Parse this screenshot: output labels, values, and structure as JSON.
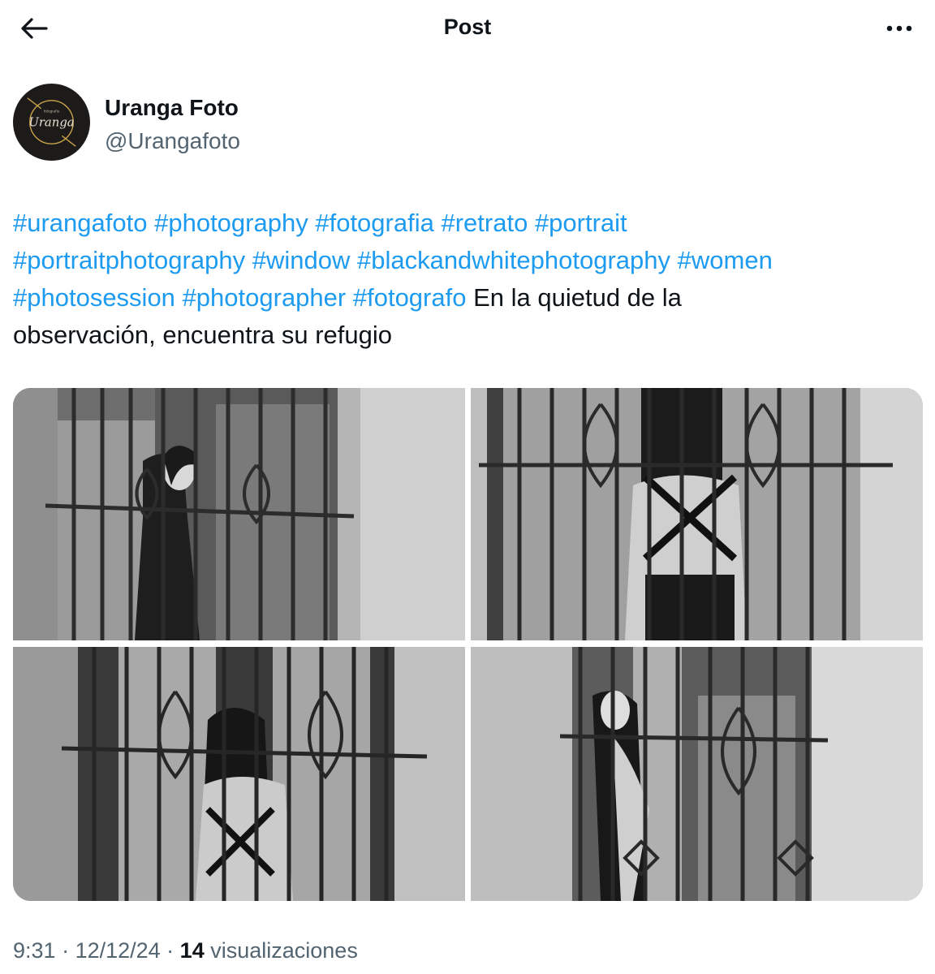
{
  "header": {
    "title": "Post"
  },
  "author": {
    "name": "Uranga Foto",
    "handle": "@Urangafoto",
    "avatar_text": "Uranga",
    "avatar_subtext": "fotografía"
  },
  "tweet": {
    "lines": [
      [
        {
          "type": "tag",
          "text": "#urangafoto"
        },
        {
          "type": "text",
          "text": " "
        },
        {
          "type": "tag",
          "text": "#photography"
        },
        {
          "type": "text",
          "text": " "
        },
        {
          "type": "tag",
          "text": "#fotografia"
        },
        {
          "type": "text",
          "text": " "
        },
        {
          "type": "tag",
          "text": "#retrato"
        },
        {
          "type": "text",
          "text": " "
        },
        {
          "type": "tag",
          "text": "#portrait"
        }
      ],
      [
        {
          "type": "tag",
          "text": "#portraitphotography"
        },
        {
          "type": "text",
          "text": " "
        },
        {
          "type": "tag",
          "text": "#window"
        },
        {
          "type": "text",
          "text": " "
        },
        {
          "type": "tag",
          "text": "#blackandwhitephotography"
        },
        {
          "type": "text",
          "text": " "
        },
        {
          "type": "tag",
          "text": "#women"
        }
      ],
      [
        {
          "type": "tag",
          "text": "#photosession"
        },
        {
          "type": "text",
          "text": " "
        },
        {
          "type": "tag",
          "text": "#photographer"
        },
        {
          "type": "text",
          "text": " "
        },
        {
          "type": "tag",
          "text": "#fotografo"
        },
        {
          "type": "text",
          "text": " En la quietud de la"
        }
      ],
      [
        {
          "type": "text",
          "text": "observación, encuentra su refugio"
        }
      ]
    ]
  },
  "meta": {
    "time": "9:31",
    "date": "12/12/24",
    "separator": " · ",
    "views_count": "14",
    "views_label": "visualizaciones"
  },
  "colors": {
    "link": "#1d9bf0",
    "text": "#0f1419",
    "secondary": "#536471",
    "avatar_bg": "#1d1b19",
    "avatar_accent": "#c9a24a"
  },
  "icons": {
    "back": "arrow-left-icon",
    "more": "more-horizontal-icon"
  }
}
